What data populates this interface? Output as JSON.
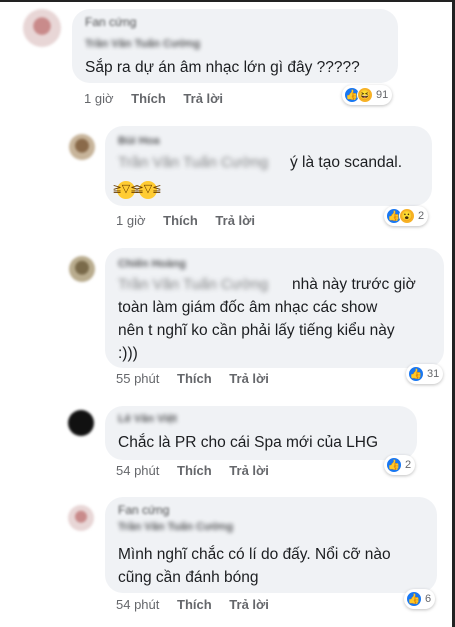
{
  "comments": [
    {
      "name": "Trần Văn Tuấn Cường",
      "tagline": "Fan cứng",
      "text_lines": [
        "Sắp ra dự án âm nhạc lớn gì đây ?????"
      ],
      "time": "1 giờ",
      "like_label": "Thích",
      "reply_label": "Trả lời",
      "reaction_icons": [
        "like-icon",
        "haha-icon"
      ],
      "reaction_count": "91"
    },
    {
      "name": "Bùi Hoa",
      "tag": "Trần Văn Tuấn Cường",
      "text_lines": [
        "ý là tạo scandal."
      ],
      "emojis": [
        "laughing-emoji",
        "laughing-emoji"
      ],
      "time": "1 giờ",
      "like_label": "Thích",
      "reply_label": "Trả lời",
      "reaction_icons": [
        "like-icon",
        "wow-icon"
      ],
      "reaction_count": "2"
    },
    {
      "name": "Chiến Hoàng",
      "tag": "Trần Văn Tuấn Cường",
      "text_lines": [
        "nhà này trước giờ",
        "toàn làm giám đốc âm nhạc các show",
        "nên t nghĩ ko cần phải lấy tiếng kiểu này",
        ":)))"
      ],
      "time": "55 phút",
      "like_label": "Thích",
      "reply_label": "Trả lời",
      "reaction_icons": [
        "like-icon"
      ],
      "reaction_count": "31"
    },
    {
      "name": "Lê Văn Việt",
      "text_lines": [
        "Chắc là PR cho cái Spa mới của LHG"
      ],
      "time": "54 phút",
      "like_label": "Thích",
      "reply_label": "Trả lời",
      "reaction_icons": [
        "like-icon"
      ],
      "reaction_count": "2"
    },
    {
      "name": "Trần Văn Tuấn Cường",
      "tagline": "Fan cứng",
      "text_lines": [
        "Mình nghĩ chắc có lí do đấy. Nổi cỡ nào",
        "cũng cần đánh bóng"
      ],
      "time": "54 phút",
      "like_label": "Thích",
      "reply_label": "Trả lời",
      "reaction_icons": [
        "like-icon"
      ],
      "reaction_count": "6"
    }
  ],
  "colors": {
    "bubble": "#f0f2f5",
    "like": "#1877f2",
    "haha": "#f7b125",
    "meta": "#65676b"
  }
}
